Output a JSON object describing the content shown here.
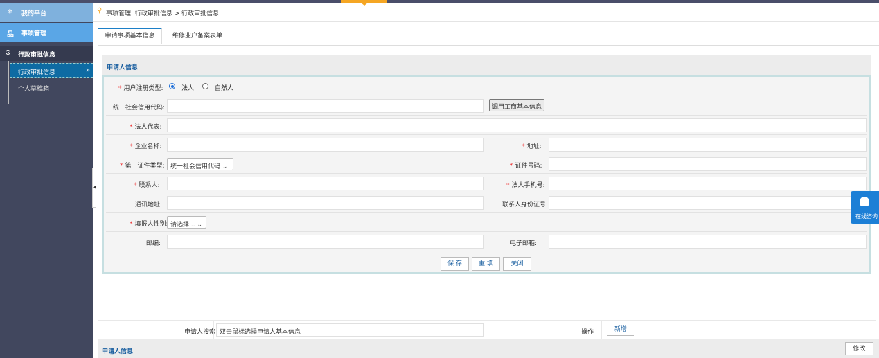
{
  "sidebar": {
    "home_label": "我的平台",
    "mgmt_label": "事项管理",
    "section_label": "行政审批信息",
    "items": [
      {
        "label": "行政审批信息",
        "active": true
      },
      {
        "label": "个人草稿箱",
        "active": false
      }
    ]
  },
  "breadcrumb": {
    "text": "事项管理:  行政审批信息  >  行政审批信息"
  },
  "tabs": [
    {
      "label": "申请事项基本信息",
      "active": true
    },
    {
      "label": "维修业户备案表单",
      "active": false
    }
  ],
  "form": {
    "section_title": "申请人信息",
    "user_type_label": "用户注册类型:",
    "user_type_options": [
      "法人",
      "自然人"
    ],
    "user_type_selected": "法人",
    "credit_code_label": "统一社会信用代码:",
    "credit_code_button": "调用工商基本信息",
    "legal_rep_label": "法人代表:",
    "company_name_label": "企业名称:",
    "address_label": "地址:",
    "first_id_type_label": "第一证件类型:",
    "first_id_type_value": "统一社会信用代码",
    "id_number_label": "证件号码:",
    "contact_label": "联系人:",
    "legal_phone_label": "法人手机号:",
    "mail_address_label": "通讯地址:",
    "contact_id_label": "联系人身份证号:",
    "filler_gender_label": "填报人性别:",
    "filler_gender_value": "请选择...",
    "postcode_label": "邮编:",
    "email_label": "电子邮箱:",
    "save_label": "保 存",
    "reset_label": "重 填",
    "close_label": "关闭"
  },
  "chat": {
    "label": "在线咨询"
  },
  "bottom": {
    "search_label": "申请人搜索",
    "search_value": "双击鼠标选择申请人基本信息",
    "action_label": "操作",
    "add_label": "新增",
    "info_title": "申请人信息",
    "edit_label": "修改"
  },
  "colors": {
    "sidebar_bg": "#41475e",
    "accent": "#1c7fc7",
    "required": "#e33333",
    "frame": "#c6dfe1"
  }
}
